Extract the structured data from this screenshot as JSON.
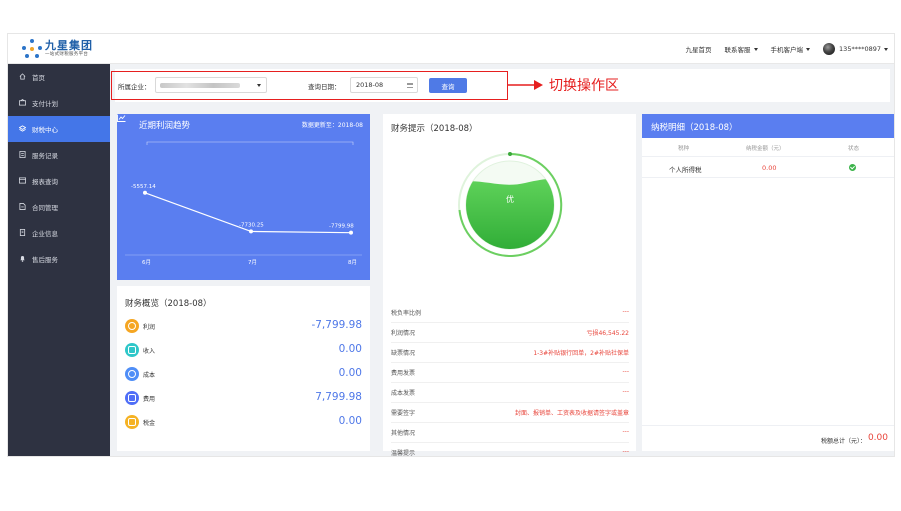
{
  "header": {
    "logo_title": "九星集团",
    "logo_subtitle": "一站式财税服务平台",
    "nav": [
      {
        "label": "九星首页",
        "has_caret": false
      },
      {
        "label": "联系客服",
        "has_caret": true
      },
      {
        "label": "手机客户端",
        "has_caret": true
      }
    ],
    "user": "135****0897"
  },
  "sidebar": {
    "items": [
      {
        "label": "首页",
        "icon": "home-icon",
        "active": false
      },
      {
        "label": "支付计划",
        "icon": "wallet-icon",
        "active": false
      },
      {
        "label": "财税中心",
        "icon": "layers-icon",
        "active": true
      },
      {
        "label": "服务记录",
        "icon": "record-icon",
        "active": false
      },
      {
        "label": "报表查询",
        "icon": "report-icon",
        "active": false
      },
      {
        "label": "合同管理",
        "icon": "contract-icon",
        "active": false
      },
      {
        "label": "企业信息",
        "icon": "building-icon",
        "active": false
      },
      {
        "label": "售后服务",
        "icon": "bell-icon",
        "active": false
      }
    ]
  },
  "filter": {
    "company_label": "所属企业：",
    "date_label": "查询日期：",
    "date_value": "2018-08",
    "query_button": "查询"
  },
  "annotation": {
    "text": "切换操作区",
    "color": "#e61f1f"
  },
  "trend": {
    "title": "近期利润趋势",
    "updated": "数据更新至：2018-08"
  },
  "chart_data": {
    "type": "line",
    "title": "近期利润趋势",
    "categories": [
      "6月",
      "7月",
      "8月"
    ],
    "series": [
      {
        "values": [
          -5557.14,
          -7730.25,
          -7799.98
        ],
        "labels": [
          "-5557.14",
          "-7730.25",
          "-7799.98"
        ]
      }
    ],
    "ylim": [
      -9000,
      -4500
    ],
    "grid": false,
    "background": "#5a7ef0",
    "line_color": "#ffffff"
  },
  "overview": {
    "title": "财务概览（2018-08）",
    "rows": [
      {
        "label": "利润",
        "value": "-7,799.98",
        "icon": "profit-icon",
        "color": "#f5a623"
      },
      {
        "label": "收入",
        "value": "0.00",
        "icon": "income-icon",
        "color": "#2ec7c9"
      },
      {
        "label": "成本",
        "value": "0.00",
        "icon": "cost-icon",
        "color": "#4f8ef7"
      },
      {
        "label": "费用",
        "value": "7,799.98",
        "icon": "expense-icon",
        "color": "#4f6ef7"
      },
      {
        "label": "税金",
        "value": "0.00",
        "icon": "tax-icon",
        "color": "#f5b223"
      }
    ]
  },
  "tips": {
    "title": "财务提示（2018-08）",
    "gauge_label": "优",
    "gauge_level": 0.75,
    "rows": [
      {
        "label": "税负率比例",
        "value": "---"
      },
      {
        "label": "利润情况",
        "value": "亏损46,545.22"
      },
      {
        "label": "缺票情况",
        "value": "1-3#补贴银行回单，2#补贴社保单"
      },
      {
        "label": "费用发票",
        "value": "---"
      },
      {
        "label": "成本发票",
        "value": "---"
      },
      {
        "label": "需要签字",
        "value": "封面、报销单、工资表及收据请签字或盖章"
      },
      {
        "label": "其他情况",
        "value": "---"
      },
      {
        "label": "温馨提示",
        "value": "---"
      }
    ]
  },
  "tax": {
    "title": "纳税明细（2018-08）",
    "headers": [
      "税种",
      "纳税金额（元）",
      "状态"
    ],
    "rows": [
      {
        "name": "个人所得税",
        "amount": "0.00",
        "status": "ok"
      }
    ],
    "total_label": "税额总计（元）：",
    "total_value": "0.00"
  }
}
